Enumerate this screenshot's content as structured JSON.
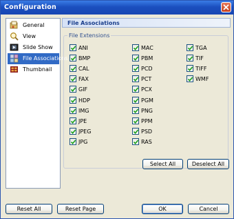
{
  "window": {
    "title": "Configuration"
  },
  "nav": {
    "items": [
      {
        "label": "General",
        "icon": "general-icon",
        "selected": false
      },
      {
        "label": "View",
        "icon": "magnifier-icon",
        "selected": false
      },
      {
        "label": "Slide Show",
        "icon": "slideshow-icon",
        "selected": false
      },
      {
        "label": "File Associations",
        "icon": "file-associations-icon",
        "selected": true
      },
      {
        "label": "Thumbnail",
        "icon": "thumbnail-icon",
        "selected": false
      }
    ]
  },
  "content": {
    "header": "File Associations",
    "group_label": "File Extensions",
    "extensions": [
      [
        "ANI",
        "BMP",
        "CAL",
        "FAX",
        "GIF",
        "HDP",
        "IMG",
        "JPE",
        "JPEG",
        "JPG"
      ],
      [
        "MAC",
        "PBM",
        "PCD",
        "PCT",
        "PCX",
        "PGM",
        "PNG",
        "PPM",
        "PSD",
        "RAS"
      ],
      [
        "TGA",
        "TIF",
        "TIFF",
        "WMF"
      ]
    ],
    "select_all": "Select All",
    "deselect_all": "Deselect All"
  },
  "footer": {
    "reset_all": "Reset All",
    "reset_page": "Reset Page",
    "ok": "OK",
    "cancel": "Cancel"
  },
  "colors": {
    "title_bar": "#1b4fbf",
    "selection": "#316ac5",
    "dialog_bg": "#ece9d8",
    "check_mark": "#21a121"
  }
}
